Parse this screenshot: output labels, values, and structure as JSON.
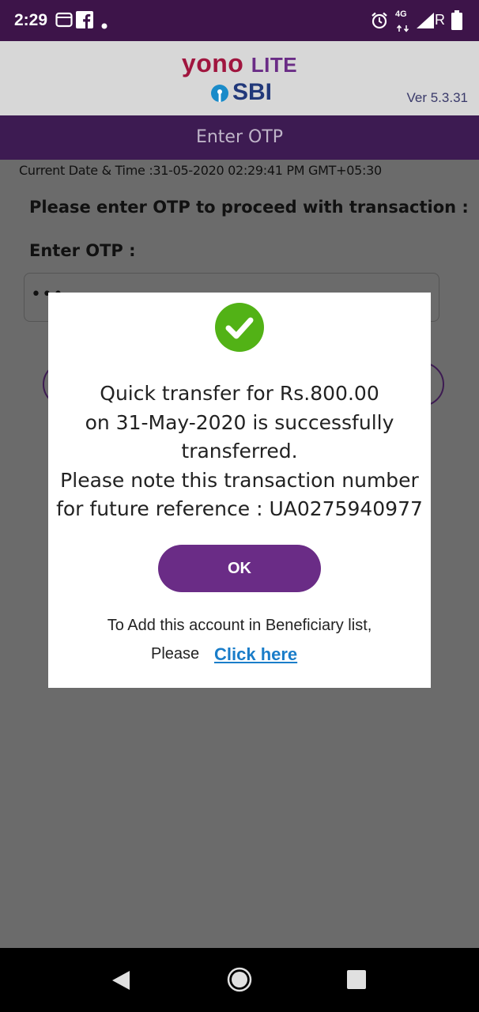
{
  "status_bar": {
    "time": "2:29",
    "network": "4G",
    "roaming": "R",
    "icons": [
      "gallery-icon",
      "facebook-icon",
      "dot-icon",
      "alarm-icon",
      "signal-icon",
      "battery-icon"
    ]
  },
  "header": {
    "logo_yono": "yono",
    "logo_lite": "LITE",
    "logo_sbi": "SBI",
    "version": "Ver 5.3.31"
  },
  "title": "Enter OTP",
  "page": {
    "datetime": "Current Date & Time :31-05-2020 02:29:41 PM GMT+05:30",
    "prompt": "Please enter OTP to proceed with transaction :",
    "otp_label": "Enter OTP :",
    "otp_value": "•••"
  },
  "dialog": {
    "message_lines": [
      "Quick transfer for Rs.800.00",
      "on 31-May-2020 is successfully",
      "transferred.",
      "Please note this transaction number",
      "for future reference : UA0275940977"
    ],
    "ok_label": "OK",
    "add_text": "To Add this account in Beneficiary list,",
    "please_text": "Please",
    "click_here": "Click here"
  },
  "colors": {
    "accent": "#6a2c86",
    "titlebar": "#3d1b52",
    "status_bar": "#3d1449",
    "success": "#52b216",
    "link": "#1a7dc9"
  }
}
